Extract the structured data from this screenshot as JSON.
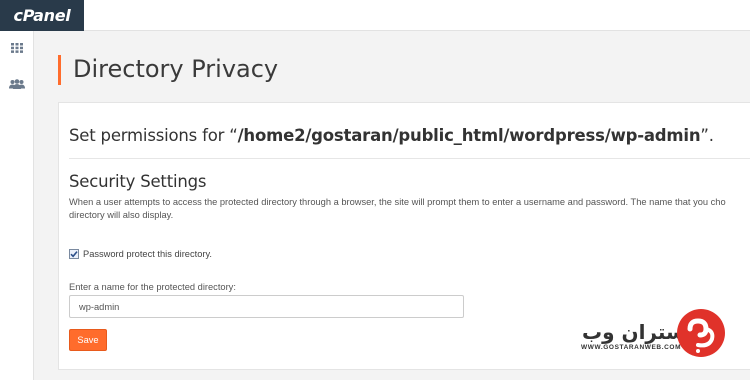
{
  "app": {
    "logo": "cPanel"
  },
  "sidebar": {
    "items": [
      {
        "icon": "grid-icon"
      },
      {
        "icon": "users-icon"
      }
    ]
  },
  "page": {
    "title": "Directory Privacy"
  },
  "permissions": {
    "prefix": "Set permissions for “",
    "path": "/home2/gostaran/public_html/wordpress/wp-admin",
    "suffix": "”."
  },
  "security": {
    "title": "Security Settings",
    "description_line1": "When a user attempts to access the protected directory through a browser, the site will prompt them to enter a username and password. The name that you cho",
    "description_line2": "directory will also display.",
    "password_protect": {
      "label": "Password protect this directory.",
      "checked": true
    },
    "name_field": {
      "label": "Enter a name for the protected directory:",
      "value": "wp-admin"
    },
    "save_label": "Save"
  },
  "watermark": {
    "brand": "گستران وب",
    "url": "WWW.GOSTARANWEB.COM"
  },
  "colors": {
    "accent": "#ff6c2c",
    "logo_bg": "#293a4a",
    "watermark_red": "#e0322a"
  }
}
